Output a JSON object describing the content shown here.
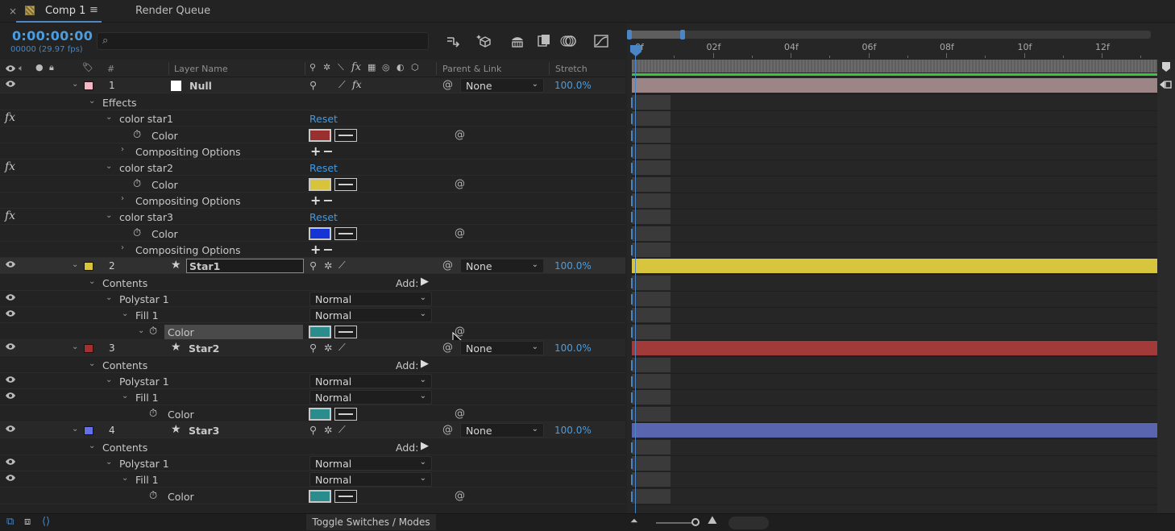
{
  "tabs": {
    "close": "×",
    "comp_title": "Comp 1",
    "menu": "≡",
    "render_queue": "Render Queue"
  },
  "toolbar": {
    "timecode": "0:00:00:00",
    "frames": "00000 (29.97 fps)",
    "search_placeholder": ""
  },
  "header": {
    "number": "#",
    "layer_name": "Layer Name",
    "parent_link": "Parent & Link",
    "stretch": "Stretch",
    "switch_fx": "fx"
  },
  "rows": {
    "r1": {
      "num": "1",
      "name": "Null",
      "parent": "None",
      "stretch": "100.0%",
      "label_color": "#f1b7c4"
    },
    "effects": "Effects",
    "e1": {
      "name": "color star1",
      "reset": "Reset",
      "prop": "Color",
      "swatch": "#9a2f2f",
      "comp": "Compositing Options",
      "fx": "fx",
      "plusminus": "+−"
    },
    "e2": {
      "name": "color star2",
      "reset": "Reset",
      "prop": "Color",
      "swatch": "#d7c43c",
      "comp": "Compositing Options",
      "fx": "fx",
      "plusminus": "+−"
    },
    "e3": {
      "name": "color star3",
      "reset": "Reset",
      "prop": "Color",
      "swatch": "#1434d6",
      "comp": "Compositing Options",
      "fx": "fx",
      "plusminus": "+−"
    },
    "r2": {
      "num": "2",
      "name": "Star1",
      "parent": "None",
      "stretch": "100.0%",
      "label_color": "#d9c53a"
    },
    "r2c": {
      "contents": "Contents",
      "add": "Add:",
      "polystar": "Polystar 1",
      "fill": "Fill 1",
      "color": "Color",
      "mode1": "Normal",
      "mode2": "Normal",
      "swatch": "#2a8c8c"
    },
    "r3": {
      "num": "3",
      "name": "Star2",
      "parent": "None",
      "stretch": "100.0%",
      "label_color": "#a33131"
    },
    "r3c": {
      "contents": "Contents",
      "add": "Add:",
      "polystar": "Polystar 1",
      "fill": "Fill 1",
      "color": "Color",
      "mode1": "Normal",
      "mode2": "Normal",
      "swatch": "#2a8c8c"
    },
    "r4": {
      "num": "4",
      "name": "Star3",
      "parent": "None",
      "stretch": "100.0%",
      "label_color": "#6670e6"
    },
    "r4c": {
      "contents": "Contents",
      "add": "Add:",
      "polystar": "Polystar 1",
      "fill": "Fill 1",
      "color": "Color",
      "mode1": "Normal",
      "mode2": "Normal",
      "swatch": "#2a8c8c"
    }
  },
  "timeline": {
    "ruler": [
      "0f",
      "02f",
      "04f",
      "06f",
      "08f",
      "10f",
      "12f"
    ],
    "bar_colors": {
      "null": "#9c8587",
      "star1": "#d7c53e",
      "star2": "#a33a3a",
      "star3": "#5a65b0"
    }
  },
  "bottom": {
    "toggle": "Toggle Switches / Modes"
  }
}
